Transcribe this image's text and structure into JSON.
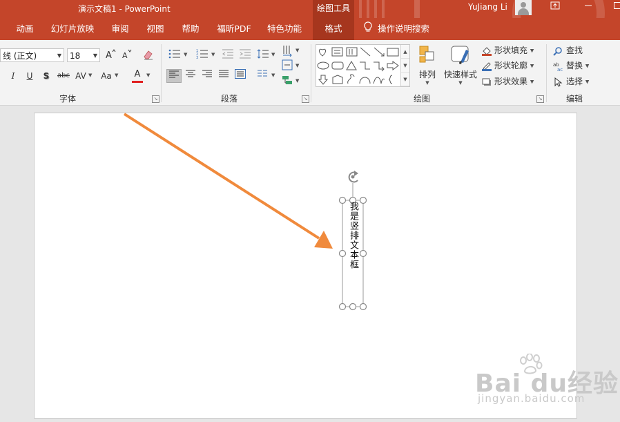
{
  "titlebar": {
    "doc_title": "演示文稿1  -  PowerPoint",
    "drawing_tools": "绘图工具",
    "user": "YuJiang Li"
  },
  "tabs": [
    "动画",
    "幻灯片放映",
    "审阅",
    "视图",
    "帮助",
    "福昕PDF",
    "特色功能",
    "格式"
  ],
  "tell_me": "操作说明搜索",
  "ribbon": {
    "font": {
      "name": "线 (正文)",
      "size": "18",
      "label": "字体",
      "buttons": [
        "I",
        "U",
        "S",
        "abc",
        "AV",
        "Aa",
        "A"
      ]
    },
    "paragraph": {
      "label": "段落"
    },
    "drawing": {
      "label": "绘图",
      "arrange": "排列",
      "quick_styles": "快速样式",
      "shape_fill": "形状填充",
      "shape_outline": "形状轮廓",
      "shape_effects": "形状效果"
    },
    "editing": {
      "label": "编辑",
      "find": "查找",
      "replace": "替换",
      "select": "选择"
    }
  },
  "slide": {
    "vertical_text": "我是竖排文本框",
    "arrow_color": "#f08a3c"
  },
  "watermark": {
    "brand": "Bai du经验",
    "site": "jingyan.baidu.com"
  },
  "colors": {
    "accent": "#c4452a",
    "accent_dark": "#a6361e",
    "font_color_bar": "#e02020"
  }
}
